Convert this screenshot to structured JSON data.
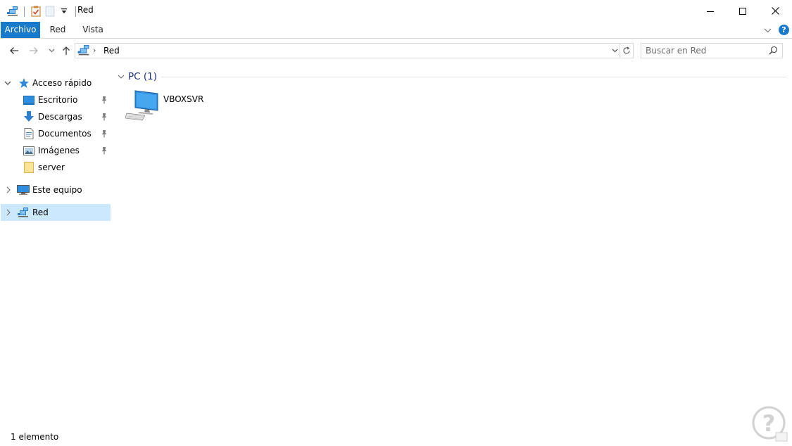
{
  "window": {
    "title": "Red",
    "controls": {
      "minimize": "minimize-icon",
      "maximize": "maximize-icon",
      "close": "close-icon"
    }
  },
  "quick_access_toolbar": {
    "icons": [
      "network-icon",
      "properties-icon",
      "new-folder-icon",
      "customize-toolbar-chevron-icon"
    ]
  },
  "ribbon": {
    "tabs": [
      {
        "label": "Archivo",
        "active": true
      },
      {
        "label": "Red",
        "active": false
      },
      {
        "label": "Vista",
        "active": false
      }
    ],
    "help_label": "?"
  },
  "navigation": {
    "back_icon": "arrow-left-icon",
    "forward_icon": "arrow-right-icon",
    "recent_icon": "chevron-down-icon",
    "up_icon": "arrow-up-icon"
  },
  "address_bar": {
    "separator": "›",
    "breadcrumb": "Red"
  },
  "search": {
    "placeholder": "Buscar en Red"
  },
  "sidebar": {
    "quick_access": {
      "label": "Acceso rápido",
      "expanded": true,
      "items": [
        {
          "label": "Escritorio",
          "icon": "desktop-icon",
          "pinned": true
        },
        {
          "label": "Descargas",
          "icon": "downloads-icon",
          "pinned": true
        },
        {
          "label": "Documentos",
          "icon": "documents-icon",
          "pinned": true
        },
        {
          "label": "Imágenes",
          "icon": "pictures-icon",
          "pinned": true
        },
        {
          "label": "server",
          "icon": "folder-icon",
          "pinned": false
        }
      ]
    },
    "this_pc": {
      "label": "Este equipo",
      "expanded": false
    },
    "network": {
      "label": "Red",
      "expanded": false,
      "selected": true
    }
  },
  "content": {
    "group_title": "PC (1)",
    "items": [
      {
        "name": "VBOXSVR",
        "icon": "computer-icon"
      }
    ]
  },
  "status_bar": {
    "text": "1 elemento"
  },
  "colors": {
    "accent": "#1979ca",
    "selection": "#cce8ff",
    "group_title": "#1e3287"
  }
}
